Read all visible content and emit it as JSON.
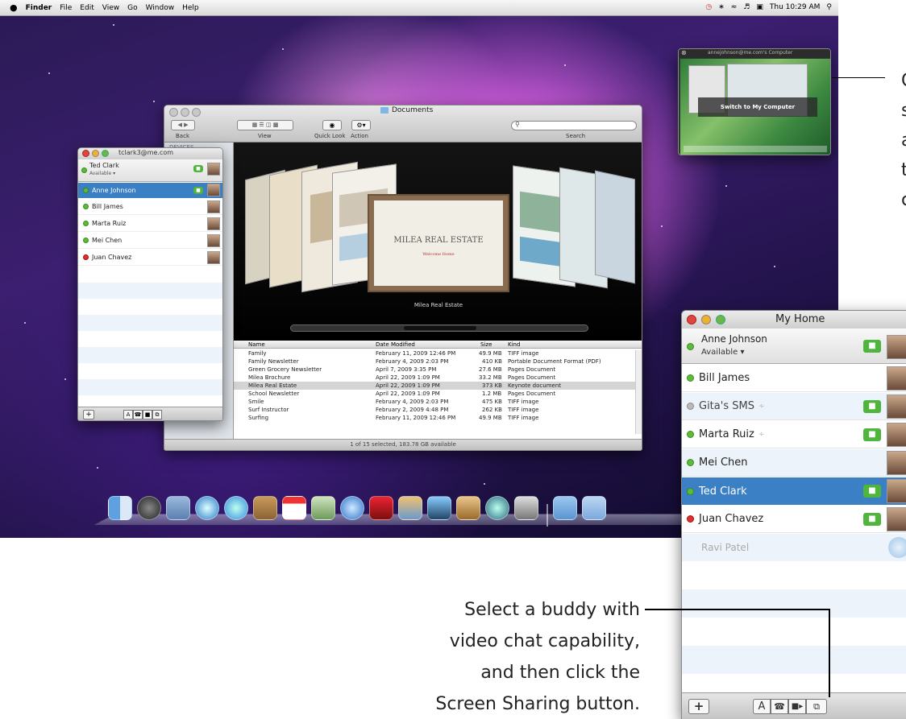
{
  "menubar": {
    "apple": "",
    "app": "Finder",
    "items": [
      "File",
      "Edit",
      "View",
      "Go",
      "Window",
      "Help"
    ],
    "clock": "Thu 10:29 AM"
  },
  "finder": {
    "title": "Documents",
    "back_label": "Back",
    "view_label": "View",
    "quicklook_label": "Quick Look",
    "action_label": "Action",
    "search_label": "Search",
    "sidebar_header": "DEVICES",
    "coverflow_caption": "Milea Real Estate",
    "card_title": "MILEA REAL ESTATE",
    "card_subtitle": "Welcome Home",
    "columns": {
      "name": "Name",
      "date": "Date Modified",
      "size": "Size",
      "kind": "Kind"
    },
    "files": [
      {
        "name": "Family",
        "date": "February 11, 2009 12:46 PM",
        "size": "49.9 MB",
        "kind": "TIFF image"
      },
      {
        "name": "Family Newsletter",
        "date": "February 4, 2009 2:03 PM",
        "size": "410 KB",
        "kind": "Portable Document Format (PDF)"
      },
      {
        "name": "Green Grocery Newsletter",
        "date": "April 7, 2009 3:35 PM",
        "size": "27.6 MB",
        "kind": "Pages Document"
      },
      {
        "name": "Milea Brochure",
        "date": "April 22, 2009 1:09 PM",
        "size": "33.2 MB",
        "kind": "Pages Document"
      },
      {
        "name": "Milea Real Estate",
        "date": "April 22, 2009 1:09 PM",
        "size": "373 KB",
        "kind": "Keynote document"
      },
      {
        "name": "School Newsletter",
        "date": "April 22, 2009 1:09 PM",
        "size": "1.2 MB",
        "kind": "Pages Document"
      },
      {
        "name": "Smile",
        "date": "February 4, 2009 2:03 PM",
        "size": "475 KB",
        "kind": "TIFF image"
      },
      {
        "name": "Surf Instructor",
        "date": "February 2, 2009 4:48 PM",
        "size": "262 KB",
        "kind": "TIFF image"
      },
      {
        "name": "Surfing",
        "date": "February 11, 2009 12:46 PM",
        "size": "49.9 MB",
        "kind": "TIFF image"
      }
    ],
    "status": "1 of 15 selected, 183.78 GB available"
  },
  "small_ichat": {
    "title": "tclark3@me.com",
    "me_name": "Ted Clark",
    "me_status": "Available ▾",
    "buddies": [
      "Anne Johnson",
      "Bill James",
      "Marta Ruiz",
      "Mei Chen",
      "Juan Chavez"
    ]
  },
  "share_window": {
    "title": "annejohnson@me.com's Computer",
    "button": "Switch to My Computer"
  },
  "big_ichat": {
    "title": "My Home",
    "me_name": "Anne Johnson",
    "me_status": "Available ▾",
    "buddies": [
      {
        "name": "Bill James"
      },
      {
        "name": "Gita's SMS"
      },
      {
        "name": "Marta Ruiz"
      },
      {
        "name": "Mei Chen"
      },
      {
        "name": "Ted Clark"
      },
      {
        "name": "Juan Chavez"
      },
      {
        "name": "Ravi Patel"
      }
    ],
    "add_label": "+",
    "text_label": "A"
  },
  "callout_top": {
    "lines": [
      "C",
      "s",
      "a",
      "t",
      "c"
    ]
  },
  "callout_bottom": {
    "lines": [
      "Select a buddy with",
      "video chat capability,",
      "and then click the",
      "Screen Sharing button."
    ]
  },
  "colors": {
    "selection": "#3b7fc4",
    "video_green": "#4fb53d",
    "status_green": "#5dbb3a",
    "status_red": "#e03030"
  }
}
